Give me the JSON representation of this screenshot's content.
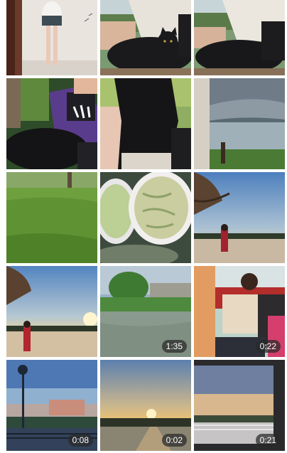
{
  "gallery": {
    "items": [
      {
        "name": "photo-girl-mirror",
        "type": "photo",
        "duration": ""
      },
      {
        "name": "photo-black-cat-lap-1",
        "type": "photo",
        "duration": ""
      },
      {
        "name": "photo-black-cat-lap-2",
        "type": "photo",
        "duration": ""
      },
      {
        "name": "photo-cat-jacket",
        "type": "photo",
        "duration": ""
      },
      {
        "name": "photo-cat-closeup",
        "type": "photo",
        "duration": ""
      },
      {
        "name": "photo-lake-view",
        "type": "photo",
        "duration": ""
      },
      {
        "name": "photo-grass-field",
        "type": "photo",
        "duration": ""
      },
      {
        "name": "photo-food-plates",
        "type": "photo",
        "duration": ""
      },
      {
        "name": "photo-sunset-girl-1",
        "type": "photo",
        "duration": ""
      },
      {
        "name": "photo-sunset-girl-2",
        "type": "photo",
        "duration": ""
      },
      {
        "name": "video-river-park",
        "type": "video",
        "duration": "1:35"
      },
      {
        "name": "video-red-bridge",
        "type": "video",
        "duration": "0:22"
      },
      {
        "name": "video-lamp-sunset",
        "type": "video",
        "duration": "0:08"
      },
      {
        "name": "video-sunset-road",
        "type": "video",
        "duration": "0:02"
      },
      {
        "name": "video-window-sunset",
        "type": "video",
        "duration": "0:21"
      }
    ]
  },
  "colors": {
    "badge_bg": "#2b2b2b",
    "badge_text": "#ffffff",
    "background": "#ffffff"
  }
}
